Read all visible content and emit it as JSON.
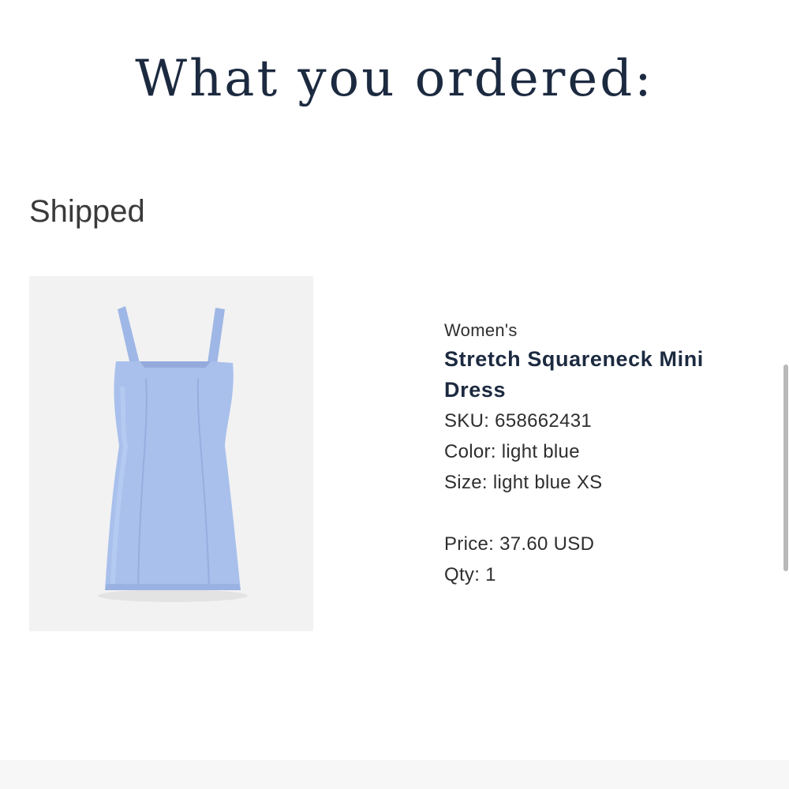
{
  "heading": "What you ordered:",
  "status": "Shipped",
  "item": {
    "image": {
      "icon": "dress-product-image",
      "color": "#a9c0ec"
    },
    "category": "Women's",
    "name": "Stretch Squareneck Mini Dress",
    "sku": "SKU: 658662431",
    "color": "Color: light blue",
    "size": "Size: light blue XS",
    "price": "Price: 37.60 USD",
    "qty": "Qty: 1"
  }
}
